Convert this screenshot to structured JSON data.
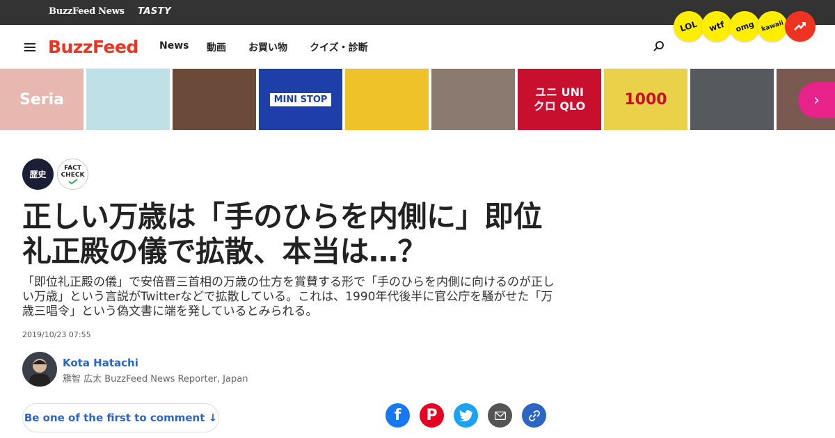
{
  "topbar": {
    "brand_news": "BuzzFeed News",
    "brand_tasty": "TASTY"
  },
  "reactions": [
    "LOL",
    "wtf",
    "omg",
    "kawaii"
  ],
  "nav": {
    "logo": "BuzzFeed",
    "links": [
      "News",
      "動画",
      "お買い物",
      "クイズ・診断"
    ]
  },
  "strip": {
    "thumbs": [
      {
        "label": "Seria",
        "color": "#e6b8b0"
      },
      {
        "label": "",
        "color": "#bfe0e6"
      },
      {
        "label": "",
        "color": "#6b4a3a"
      },
      {
        "label": "MINI STOP",
        "color": "#1f3fa8"
      },
      {
        "label": "",
        "color": "#f0c22a"
      },
      {
        "label": "",
        "color": "#8a7a70"
      },
      {
        "label": "ユニ UNI クロ QLO",
        "color": "#c8102e"
      },
      {
        "label": "1000",
        "color": "#e9d14a"
      },
      {
        "label": "",
        "color": "#56595e"
      },
      {
        "label": "",
        "color": "#7a5a50"
      }
    ]
  },
  "article": {
    "category": "歴史",
    "factcheck": [
      "FACT",
      "CHECK"
    ],
    "title": "正しい万歳は「手のひらを内側に」即位礼正殿の儀で拡散、本当は…？",
    "description": "「即位礼正殿の儀」で安倍晋三首相の万歳の仕方を賞賛する形で「手のひらを内側に向けるのが正しい万歳」という言説がTwitterなどで拡散している。これは、1990年代後半に官公庁を騒がせた「万歳三唱令」という偽文書に端を発しているとみられる。",
    "date": "2019/10/23 07:55",
    "author_name": "Kota Hatachi",
    "author_title": "籏智 広太 BuzzFeed News Reporter, Japan",
    "comment_label": "Be one of the first to comment ↓"
  },
  "colors": {
    "brand_red": "#ee3322",
    "link_blue": "#2b66c7",
    "facebook": "#1877f2",
    "pinterest": "#e60023",
    "twitter": "#1da1f2",
    "email": "#555555",
    "link": "#2b66c7"
  }
}
